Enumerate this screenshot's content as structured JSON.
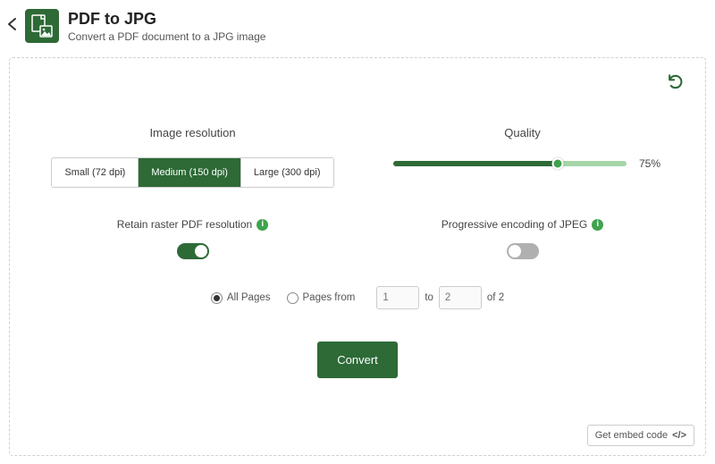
{
  "header": {
    "title": "PDF to JPG",
    "subtitle": "Convert a PDF document to a JPG image"
  },
  "resolution": {
    "title": "Image resolution",
    "options": [
      "Small (72 dpi)",
      "Medium (150 dpi)",
      "Large (300 dpi)"
    ]
  },
  "quality": {
    "title": "Quality",
    "value": "75%"
  },
  "retain": {
    "title": "Retain raster PDF resolution"
  },
  "progressive": {
    "title": "Progressive encoding of JPEG"
  },
  "pages": {
    "all": "All Pages",
    "from": "Pages from",
    "to": "to",
    "p1": "1",
    "p2": "2",
    "of": "of 2"
  },
  "convert": "Convert",
  "embed": "Get embed code",
  "undo_glyph": "⟲",
  "info_glyph": "i",
  "code_glyph": "</>"
}
